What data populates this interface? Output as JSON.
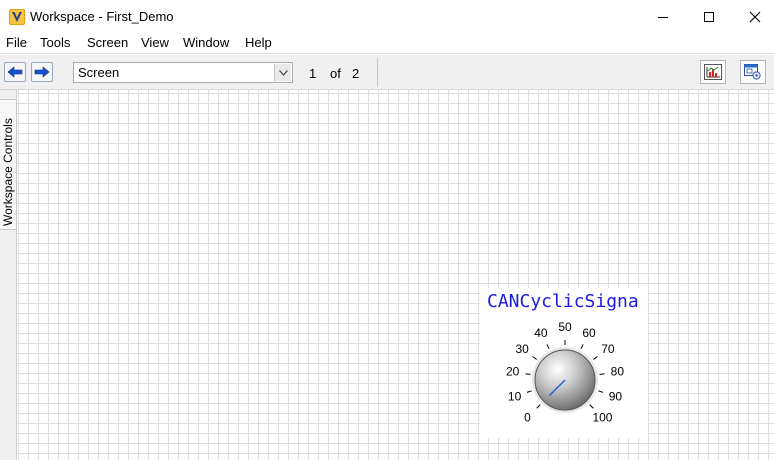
{
  "window": {
    "title": "Workspace - First_Demo",
    "controls": {
      "minimize": "minimize-icon",
      "maximize": "maximize-icon",
      "close": "close-icon"
    }
  },
  "menu": {
    "items": [
      "File",
      "Tools",
      "Screen",
      "View",
      "Window",
      "Help"
    ]
  },
  "toolbar": {
    "back_icon": "arrow-left-icon",
    "forward_icon": "arrow-right-icon",
    "screen_select": {
      "value": "Screen"
    },
    "page": {
      "current": "1",
      "of_label": "of",
      "total": "2"
    },
    "right_icons": [
      "chart-icon",
      "window-settings-icon"
    ]
  },
  "side_panel": {
    "label": "Workspace Controls"
  },
  "knob": {
    "title": "CANCyclicSigna",
    "ticks": [
      "0",
      "10",
      "20",
      "30",
      "40",
      "50",
      "60",
      "70",
      "80",
      "90",
      "100"
    ],
    "min": 0,
    "max": 100,
    "value": 0,
    "colors": {
      "title": "#1a1ae6",
      "pointer": "#1a5fd6"
    }
  }
}
